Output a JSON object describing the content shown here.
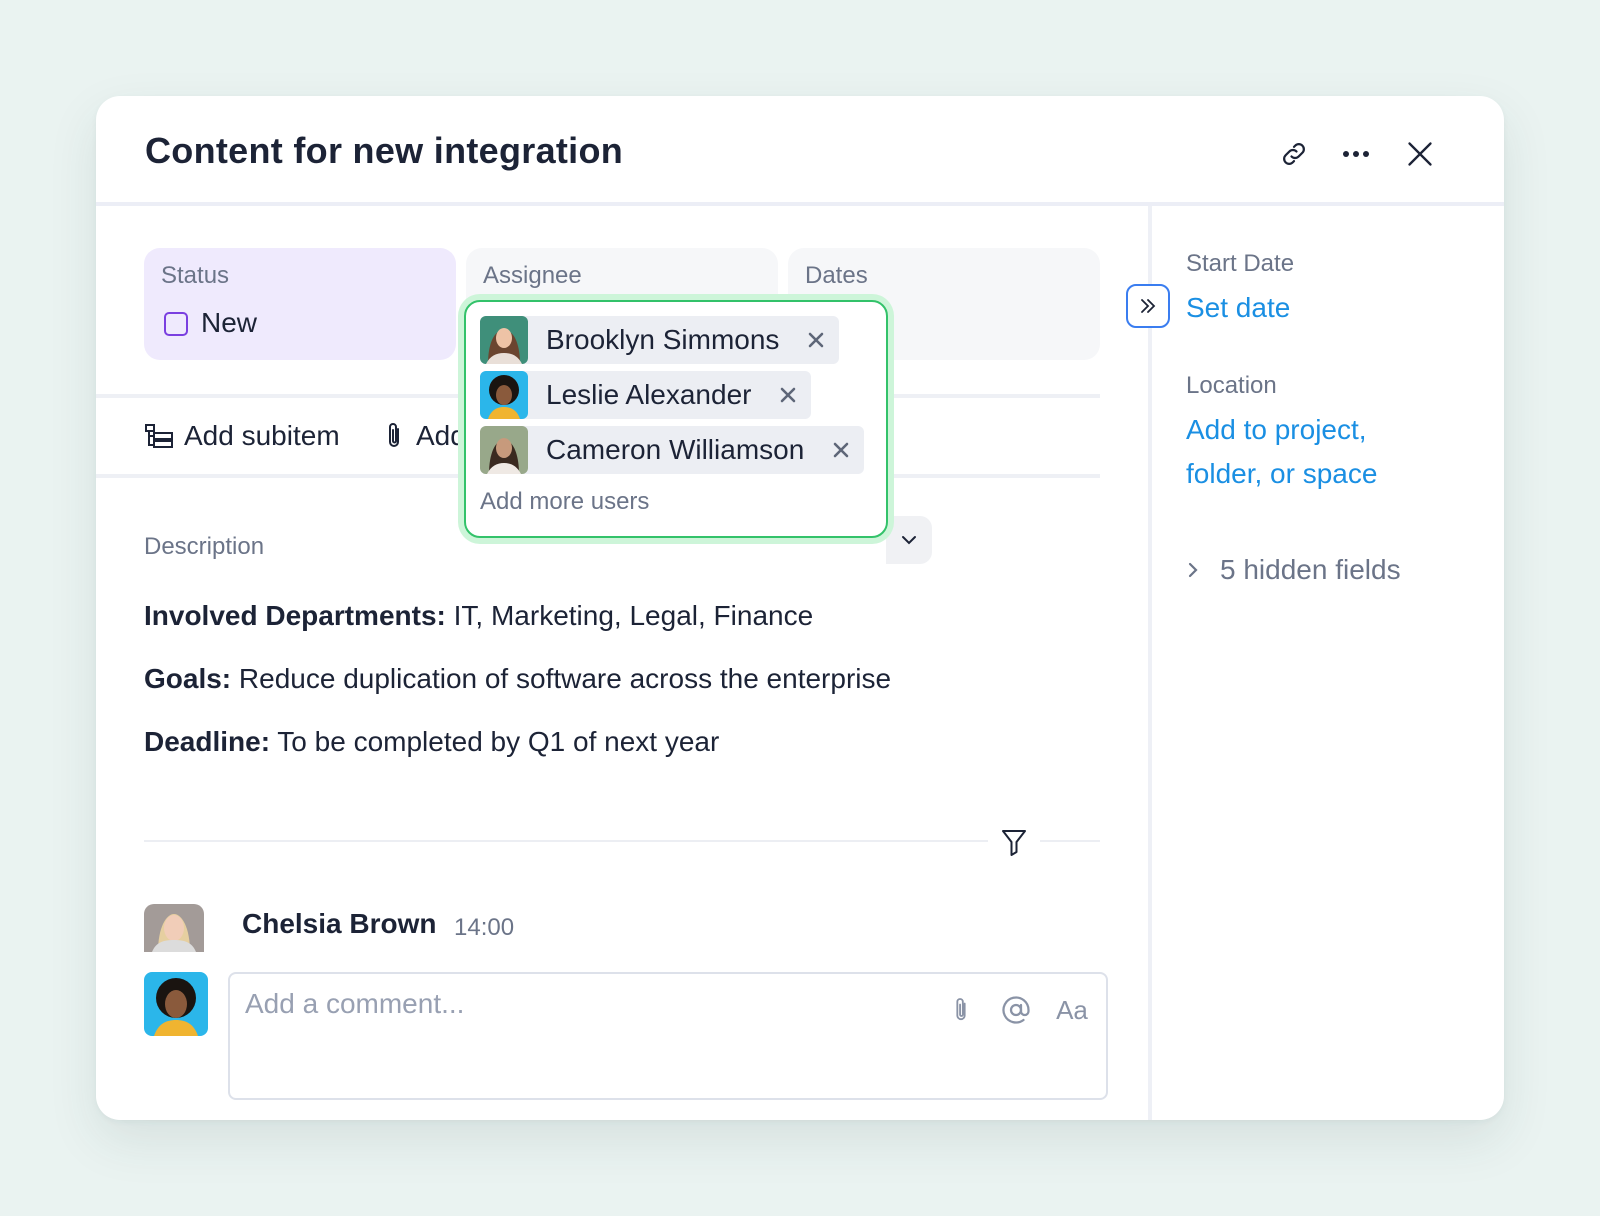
{
  "header": {
    "title": "Content for new integration",
    "icons": [
      "link-icon",
      "more-icon",
      "close-icon"
    ]
  },
  "fields": {
    "status": {
      "label": "Status",
      "value": "New",
      "color": "#7a3fe0"
    },
    "assignee": {
      "label": "Assignee"
    },
    "dates": {
      "label": "Dates"
    }
  },
  "assignee_popover": {
    "users": [
      {
        "name": "Brooklyn Simmons"
      },
      {
        "name": "Leslie Alexander"
      },
      {
        "name": "Cameron Williamson"
      }
    ],
    "add_more": "Add more users",
    "accent": "#33c26a"
  },
  "toolbar": {
    "add_subitem": "Add subitem",
    "add_partial": "Add"
  },
  "description": {
    "label": "Description",
    "lines": [
      {
        "key": "Involved Departments:",
        "value": " IT, Marketing, Legal, Finance"
      },
      {
        "key": "Goals:",
        "value": " Reduce duplication of software across the enterprise"
      },
      {
        "key": "Deadline:",
        "value": " To be completed by Q1 of next year"
      }
    ]
  },
  "activity": {
    "comment": {
      "author": "Chelsia Brown",
      "time": "14:00"
    },
    "input": {
      "placeholder": "Add a comment...",
      "format_label": "Aa"
    }
  },
  "sidebar": {
    "start_date": {
      "label": "Start Date",
      "link": "Set date"
    },
    "location": {
      "label": "Location",
      "link_line1": "Add to project,",
      "link_line2": "folder, or space"
    },
    "hidden_fields": "5 hidden fields"
  },
  "colors": {
    "link": "#1a8fe3",
    "status_bg": "#efeafd",
    "page_bg": "#eaf3f1"
  }
}
